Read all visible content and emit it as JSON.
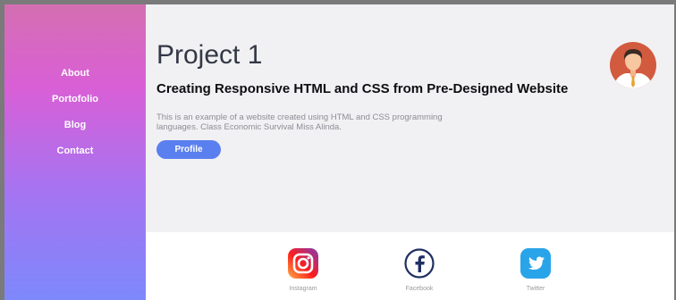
{
  "nav": {
    "items": [
      {
        "label": "About"
      },
      {
        "label": "Portofolio"
      },
      {
        "label": "Blog"
      },
      {
        "label": "Contact"
      }
    ]
  },
  "hero": {
    "title": "Project 1",
    "subtitle": "Creating Responsive HTML and CSS from Pre-Designed Website",
    "description": "This is an example of a website created using HTML and CSS programming languages. Class Economic Survival Miss Alinda.",
    "button_label": "Profile"
  },
  "social": [
    {
      "label": "Instagram",
      "icon": "instagram-icon"
    },
    {
      "label": "Facebook",
      "icon": "facebook-icon"
    },
    {
      "label": "Twitter",
      "icon": "twitter-icon"
    }
  ],
  "colors": {
    "accent": "#5a80f0",
    "sidebar_top": "#d46fb1",
    "sidebar_mid": "#d95fd6",
    "sidebar_bottom": "#7d88fb",
    "main_bg": "#f1f1f3"
  }
}
